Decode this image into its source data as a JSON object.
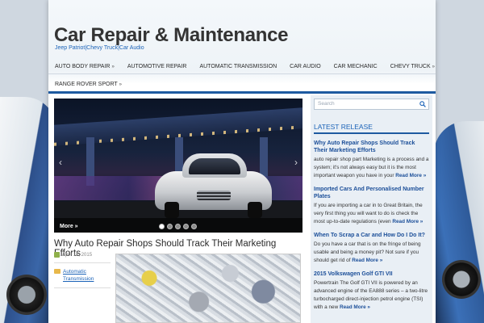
{
  "site": {
    "title": "Car Repair & Maintenance",
    "tagline": "Jeep Patriot|Chevy Truck|Car Audio"
  },
  "nav": {
    "row1": [
      {
        "label": "Auto Body Repair",
        "dropdown": true
      },
      {
        "label": "Automotive Repair",
        "dropdown": false
      },
      {
        "label": "Automatic Transmission",
        "dropdown": false
      },
      {
        "label": "Car Audio",
        "dropdown": false
      },
      {
        "label": "Car Mechanic",
        "dropdown": false
      },
      {
        "label": "Chevy Truck",
        "dropdown": true
      }
    ],
    "row2": [
      {
        "label": "Range Rover Sport",
        "dropdown": true
      }
    ],
    "arrow": "»"
  },
  "slider": {
    "more_label": "More »",
    "prev_icon": "‹",
    "next_icon": "›",
    "dot_count": 5,
    "active_dot": 0
  },
  "post": {
    "title": "Why Auto Repair Shops Should Track Their Marketing Efforts",
    "date": "April 16, 2015",
    "category": "Automatic Transmission"
  },
  "sidebar": {
    "search_placeholder": "Search",
    "widget_title": "Latest Release",
    "more_label": "Read More »",
    "items": [
      {
        "title": "Why Auto Repair Shops Should Track Their Marketing Efforts",
        "text": "auto repair shop part Marketing is a process and a system; it's not always easy but it is the most important weapon you have in your"
      },
      {
        "title": "Imported Cars And Personalised Number Plates",
        "text": "If you are importing a car in to Great Britain, the very first thing you will want to do is check the most up-to-date regulations (even"
      },
      {
        "title": "When To Scrap a Car and How Do I Do It?",
        "text": "Do you have a car that is on the fringe of being usable and being a money pit? Not sure if you should get rid of"
      },
      {
        "title": "2015 Volkswagen Golf GTI VII",
        "text": "Powertrain The Golf GTI VII is powered by an advanced engine of the EA888 series – a two-litre turbocharged direct-injection petrol engine (TSI) with a new"
      }
    ]
  },
  "colors": {
    "accent": "#1e5aa0",
    "link": "#1b63b8"
  }
}
